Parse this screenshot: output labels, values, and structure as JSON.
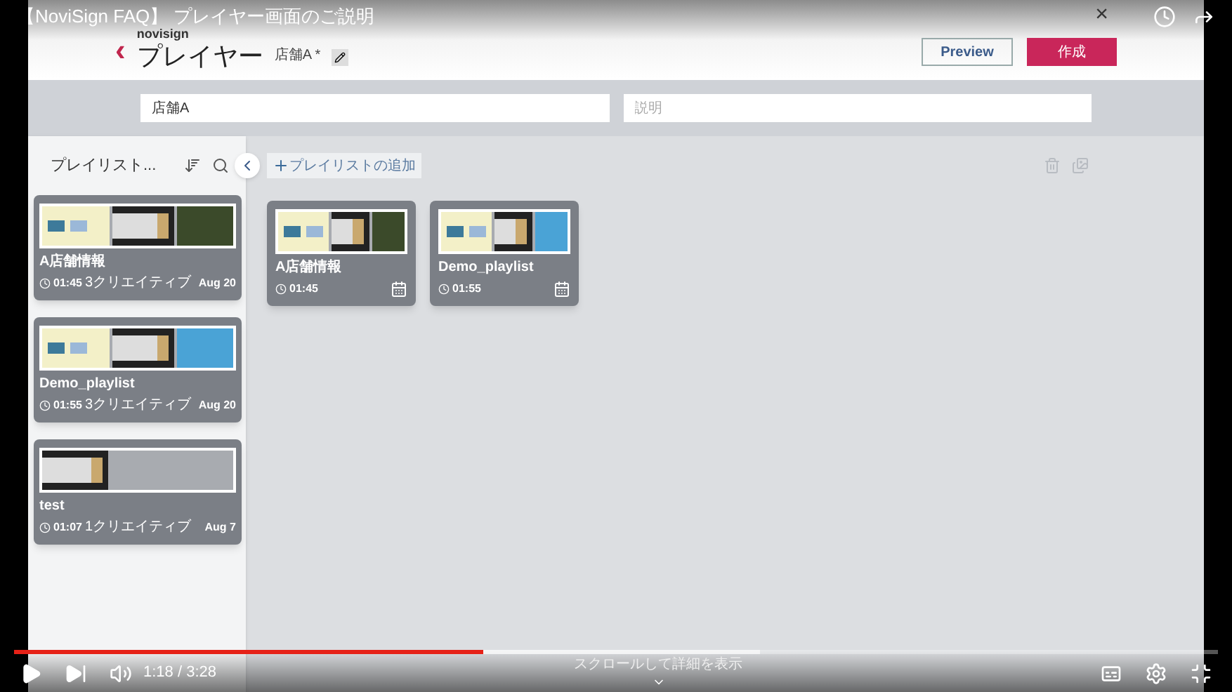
{
  "video": {
    "title": "【NoviSign FAQ】 プレイヤー画面のご説明",
    "time": "1:18 / 3:28",
    "progress": {
      "level": 0.39
    },
    "buffered": {
      "level": 0.62
    },
    "scroll_hint": "スクロールして詳細を表示"
  },
  "header": {
    "logo": "novisign",
    "back": "‹",
    "title": "プレイヤー",
    "player_name": "店舗A *",
    "close": "×",
    "buttons": [
      {
        "label": "Preview",
        "kind": "outline"
      },
      {
        "label": "作成",
        "kind": "primary"
      }
    ]
  },
  "fields": [
    {
      "value": "店舗A"
    },
    {
      "placeholder": "説明"
    }
  ],
  "sidebar": {
    "title": "プレイリスト...",
    "playlists": [
      {
        "name": "A店舗情報",
        "duration": "01:45",
        "creatives": "3クリエイティブ",
        "date": "Aug 20",
        "thumbnails": [
          {
            "kind": "slide"
          },
          {
            "kind": "video"
          },
          {
            "kind": "plant"
          }
        ]
      },
      {
        "name": "Demo_playlist",
        "duration": "01:55",
        "creatives": "3クリエイティブ",
        "date": "Aug 20",
        "thumbnails": [
          {
            "kind": "slide"
          },
          {
            "kind": "video"
          },
          {
            "kind": "house"
          }
        ]
      },
      {
        "name": "test",
        "duration": "01:07",
        "creatives": "1クリエイティブ",
        "date": "Aug 7",
        "thumbnails": [
          {
            "kind": "video"
          }
        ]
      }
    ]
  },
  "main": {
    "add_button": "プレイリストの追加",
    "playlists": [
      {
        "name": "A店舗情報",
        "duration": "01:45",
        "thumbnails": [
          {
            "kind": "slide"
          },
          {
            "kind": "video"
          },
          {
            "kind": "plant"
          }
        ]
      },
      {
        "name": "Demo_playlist",
        "duration": "01:55",
        "thumbnails": [
          {
            "kind": "slide"
          },
          {
            "kind": "video"
          },
          {
            "kind": "house"
          }
        ]
      }
    ]
  }
}
